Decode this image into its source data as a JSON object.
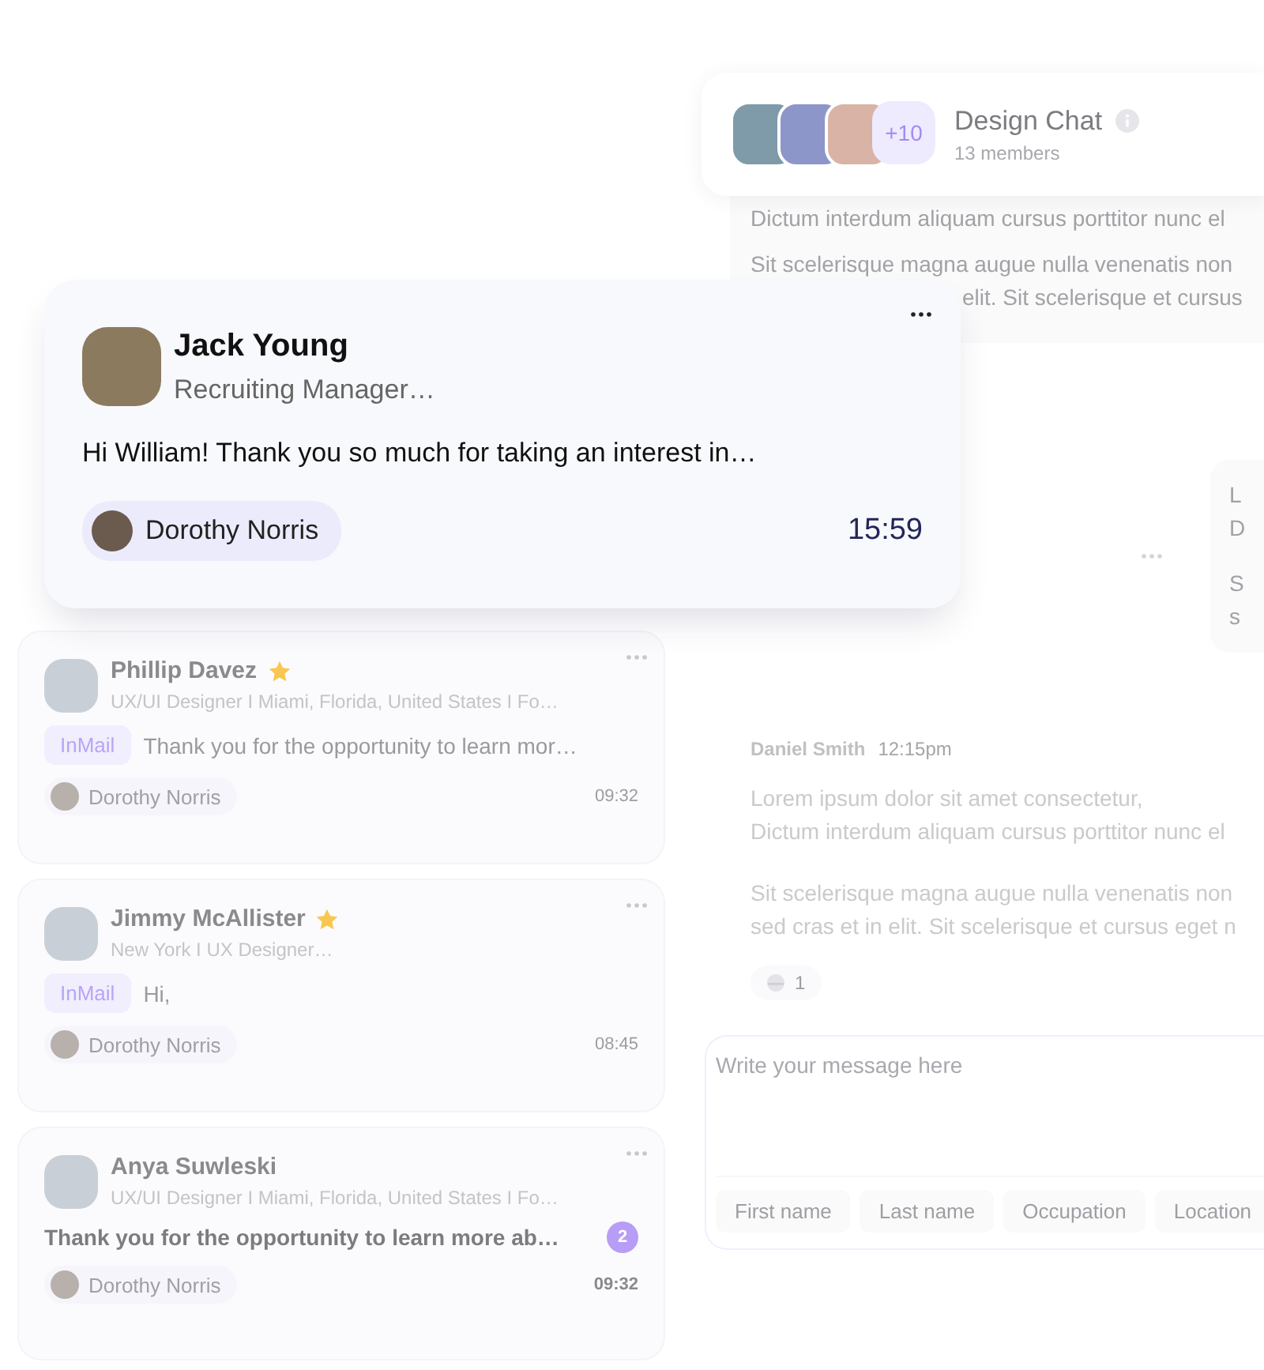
{
  "conversations": [
    {
      "name": "Phillip Davez",
      "starred": true,
      "subtitle": "UX/UI Designer I Miami, Florida, United States I Fo…",
      "tag": "InMail",
      "message": "Thank you for the opportunity to learn mor…",
      "unread": false,
      "sender": "Dorothy Norris",
      "time": "09:32"
    },
    {
      "name": "Jimmy McAllister",
      "starred": true,
      "subtitle": "New York I UX Designer…",
      "tag": "InMail",
      "message": "Hi,",
      "unread": false,
      "sender": "Dorothy Norris",
      "time": "08:45"
    },
    {
      "name": "Anya Suwleski",
      "starred": false,
      "subtitle": "UX/UI Designer I Miami, Florida, United States I Fo…",
      "message": "Thank you for the opportunity to learn more ab…",
      "unread": true,
      "badge": "2",
      "sender": "Dorothy Norris",
      "time": "09:32"
    }
  ],
  "popup": {
    "name": "Jack Young",
    "subtitle": "Recruiting Manager…",
    "message": "Hi William! Thank you so much for taking an interest in…",
    "sender": "Dorothy Norris",
    "time": "15:59"
  },
  "chat": {
    "title": "Design Chat",
    "members": "13 members",
    "extra_count": "+10",
    "messages": [
      {
        "kind": "plain",
        "paragraphs": [
          [
            "Dictum interdum aliquam cursus porttitor nunc el"
          ],
          [
            "Sit scelerisque magna augue nulla venenatis non",
            "elit. Sit scelerisque et cursus"
          ]
        ]
      },
      {
        "kind": "bubble",
        "paragraphs": [
          [
            "L",
            "D"
          ],
          [
            "S",
            "s"
          ]
        ]
      },
      {
        "kind": "authored",
        "author": "Daniel Smith",
        "time": "12:15pm",
        "paragraphs": [
          [
            "Lorem ipsum dolor sit amet consectetur,",
            "Dictum interdum aliquam cursus porttitor nunc el"
          ],
          [
            "Sit scelerisque magna augue nulla venenatis non",
            "sed cras et in elit. Sit scelerisque et cursus eget n"
          ]
        ],
        "reaction_count": "1"
      }
    ],
    "composer": {
      "placeholder": "Write your message here",
      "chips": [
        "First name",
        "Last name",
        "Occupation",
        "Location"
      ]
    }
  }
}
